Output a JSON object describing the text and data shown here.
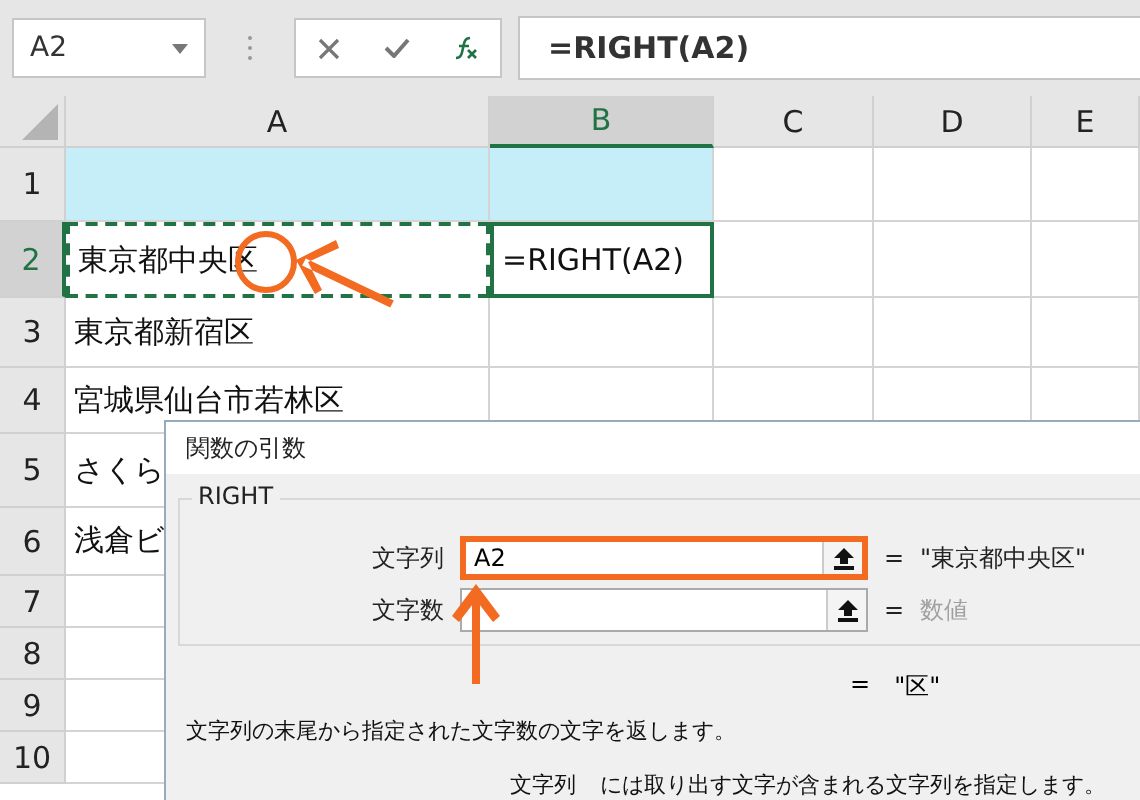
{
  "name_box": {
    "value": "A2"
  },
  "formula": {
    "value": "=RIGHT(A2)"
  },
  "columns": [
    {
      "label": "A",
      "selected": false
    },
    {
      "label": "B",
      "selected": true
    },
    {
      "label": "C",
      "selected": false
    },
    {
      "label": "D",
      "selected": false
    },
    {
      "label": "E",
      "selected": false
    }
  ],
  "rows": [
    {
      "label": "1",
      "selected": false,
      "shaded": true,
      "cells": [
        {
          "marquee": false,
          "selected": false
        },
        {
          "marquee": false,
          "selected": false
        }
      ]
    },
    {
      "label": "2",
      "selected": true,
      "shaded": false,
      "cells": [
        {
          "text": "東京都中央区",
          "marquee": true,
          "selected": false
        },
        {
          "text": "=RIGHT(A2)",
          "marquee": false,
          "selected": true
        }
      ]
    },
    {
      "label": "3",
      "selected": false,
      "shaded": false,
      "cells": [
        {
          "text": "東京都新宿区",
          "marquee": false,
          "selected": false
        },
        {
          "marquee": false,
          "selected": false
        }
      ]
    },
    {
      "label": "4",
      "selected": false,
      "shaded": false,
      "cells": [
        {
          "text": "宮城県仙台市若林区",
          "marquee": false,
          "selected": false
        },
        {
          "marquee": false,
          "selected": false
        }
      ]
    },
    {
      "label": "5",
      "selected": false,
      "shaded": false,
      "cells": [
        {
          "text": "さくら",
          "marquee": false,
          "selected": false
        }
      ]
    },
    {
      "label": "6",
      "selected": false,
      "shaded": false,
      "cells": [
        {
          "text": "浅倉ビ",
          "marquee": false,
          "selected": false
        }
      ]
    },
    {
      "label": "7",
      "selected": false,
      "shaded": false,
      "cells": [
        {
          "marquee": false,
          "selected": false
        }
      ]
    },
    {
      "label": "8",
      "selected": false,
      "shaded": false,
      "cells": [
        {
          "marquee": false,
          "selected": false
        }
      ]
    },
    {
      "label": "9",
      "selected": false,
      "shaded": false,
      "cells": [
        {
          "marquee": false,
          "selected": false
        }
      ]
    },
    {
      "label": "10",
      "selected": false,
      "shaded": false,
      "cells": [
        {
          "marquee": false,
          "selected": false
        }
      ]
    }
  ],
  "dialog": {
    "title": "関数の引数",
    "function_name": "RIGHT",
    "args": [
      {
        "label": "文字列",
        "value": "A2",
        "focused": true,
        "equals": "=",
        "result": "\"東京都中央区\"",
        "muted": false
      },
      {
        "label": "文字数",
        "focused": false,
        "equals": "=",
        "result": "数値",
        "muted": true
      }
    ],
    "result_equals": "=",
    "result": "\"区\"",
    "description": "文字列の末尾から指定された文字数の文字を返します。",
    "arg_help": {
      "name": "文字列",
      "text": "には取り出す文字が含まれる文字列を指定します。"
    }
  }
}
